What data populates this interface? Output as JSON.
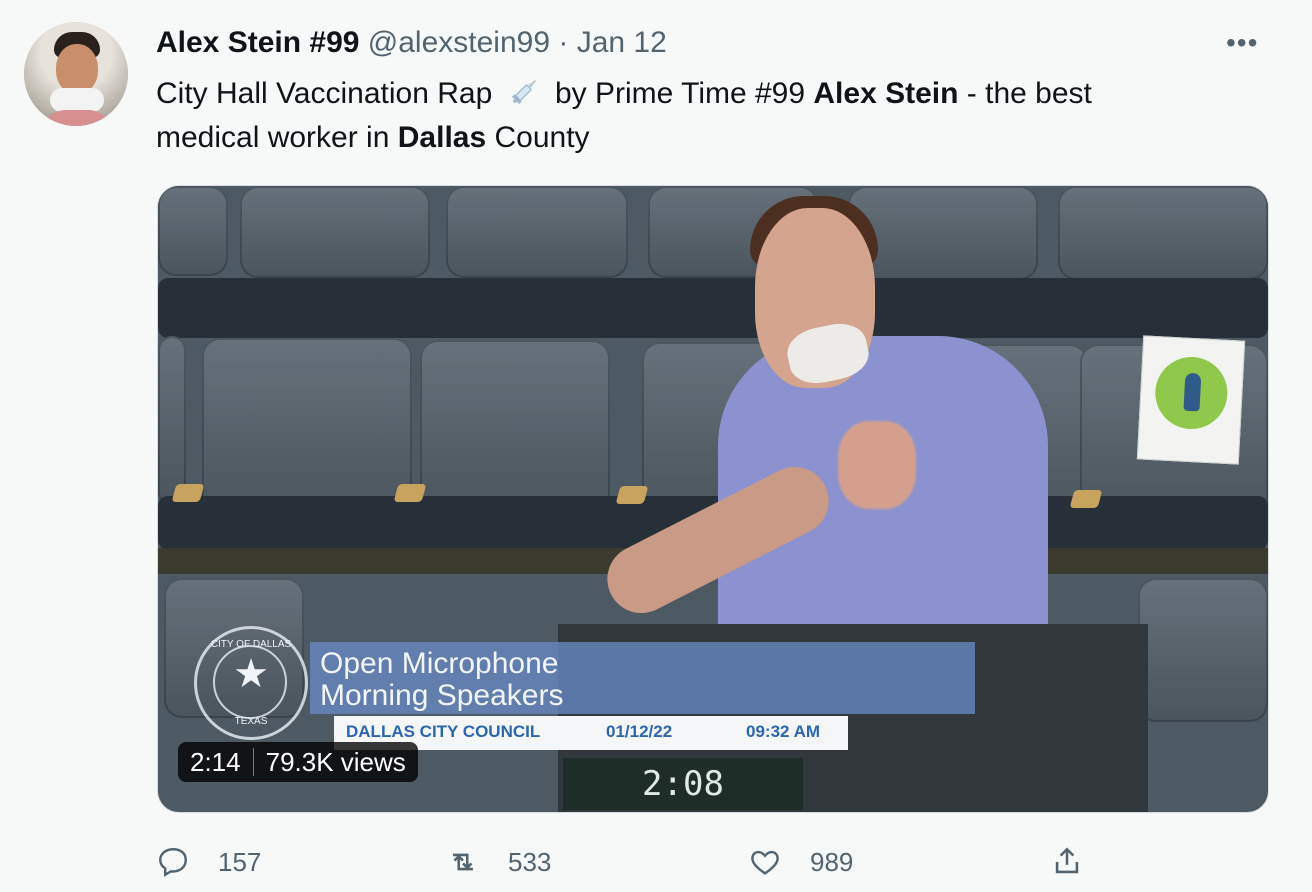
{
  "tweet": {
    "author_name": "Alex Stein #99",
    "handle": "@alexstein99",
    "date": "Jan 12",
    "text_parts": [
      "City Hall Vaccination Rap",
      "by Prime Time #99",
      "Alex Stein",
      "- the best",
      "medical worker in",
      "Dallas",
      "County"
    ],
    "more": "•••"
  },
  "video": {
    "overlay_title_line1": "Open Microphone",
    "overlay_title_line2": "Morning Speakers",
    "info_council": "DALLAS CITY COUNCIL",
    "info_date": "01/12/22",
    "info_time": "09:32 AM",
    "timer": "2:08",
    "logo_top": "CITY OF DALLAS",
    "logo_bottom": "TEXAS",
    "duration": "2:14",
    "views": "79.3K views"
  },
  "actions": {
    "reply_count": "157",
    "retweet_count": "533",
    "like_count": "989"
  },
  "icons": {
    "reply": "reply-icon",
    "retweet": "retweet-icon",
    "like": "like-icon",
    "share": "share-icon",
    "more": "more-icon",
    "syringe": "syringe-icon"
  },
  "colors": {
    "secondary_text": "#536471",
    "background": "#f7f9f9"
  }
}
